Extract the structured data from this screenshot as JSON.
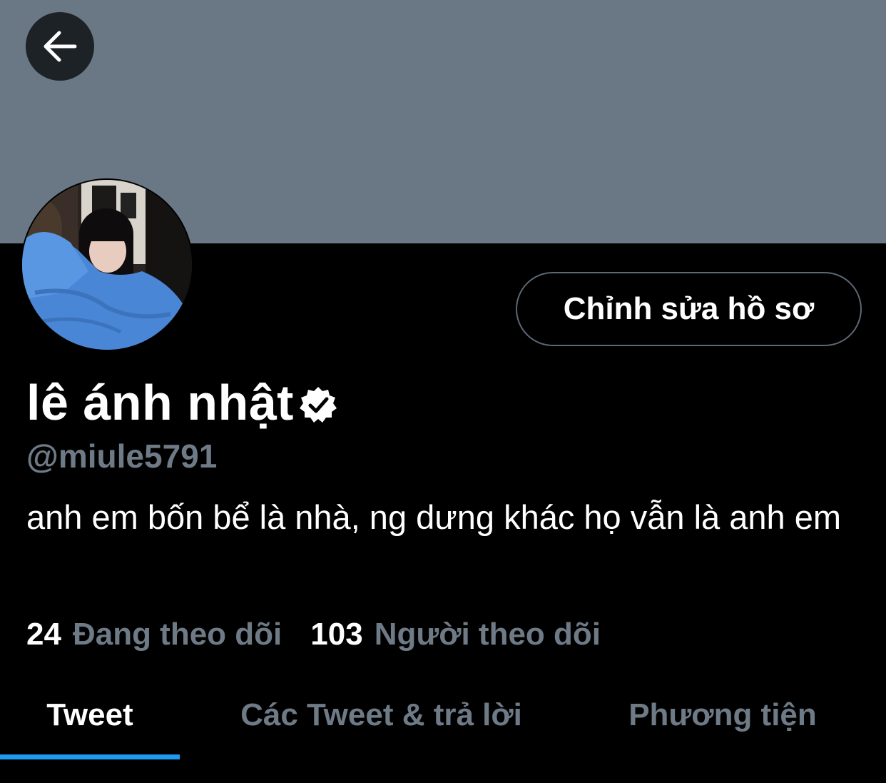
{
  "header": {
    "back_icon": "arrow-left-icon",
    "banner_color": "#6a7886"
  },
  "profile": {
    "avatar_alt": "profile photo",
    "edit_button_label": "Chỉnh sửa hồ sơ",
    "display_name": "lê ánh nhật",
    "verified_icon": "verified-badge-icon",
    "handle": "@miule5791",
    "bio": "anh em bốn bể là nhà, ng dưng khác họ vẫn là anh em"
  },
  "stats": {
    "following_count": "24",
    "following_label": "Đang theo dõi",
    "followers_count": "103",
    "followers_label": "Người theo dõi"
  },
  "tabs": [
    {
      "label": "Tweet",
      "active": true
    },
    {
      "label": "Các Tweet & trả lời",
      "active": false
    },
    {
      "label": "Phương tiện",
      "active": false
    }
  ],
  "colors": {
    "accent": "#1d9bf0",
    "secondary_text": "#6e7a86",
    "background": "#000000"
  }
}
